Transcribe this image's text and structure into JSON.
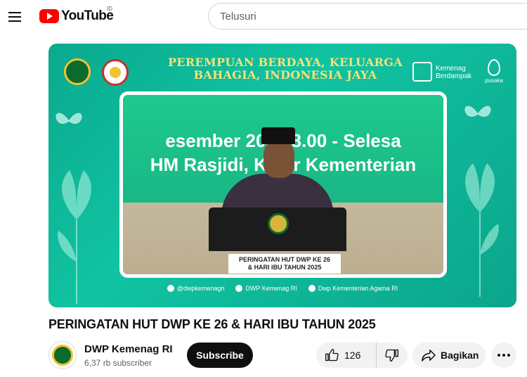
{
  "header": {
    "logo_text": "YouTube",
    "country_code": "ID",
    "search_placeholder": "Telusuri"
  },
  "video": {
    "banner_title_line1": "PEREMPUAN BERDAYA, KELUARGA",
    "banner_title_line2": "BAHAGIA, INDONESIA JAYA",
    "logo_kemenag_line1": "Kemenag",
    "logo_kemenag_line2": "Berdampak",
    "logo_pusaka": "pusaka",
    "screen_line1": "esember 202   08.00 - Selesa",
    "screen_line2": "HM Rasjidi, Ka  or Kementerian",
    "screen_caption_line1": "PERINGATAN HUT DWP KE 26",
    "screen_caption_line2": "& HARI IBU TAHUN 2025",
    "socials": [
      {
        "icon": "instagram-icon",
        "label": "@dwpkemenagri"
      },
      {
        "icon": "youtube-icon",
        "label": "DWP Kemenag RI"
      },
      {
        "icon": "facebook-icon",
        "label": "Dwp Kementerian Agama RI"
      }
    ],
    "title": "PERINGATAN HUT DWP KE 26 & HARI IBU TAHUN 2025"
  },
  "channel": {
    "name": "DWP Kemenag RI",
    "subscribers": "6,37 rb subscriber",
    "subscribe_label": "Subscribe"
  },
  "actions": {
    "like_count": "126",
    "share_label": "Bagikan"
  },
  "colors": {
    "brand_red": "#ff0000",
    "video_teal": "#11c3a2",
    "banner_gold": "#f4e27a"
  }
}
